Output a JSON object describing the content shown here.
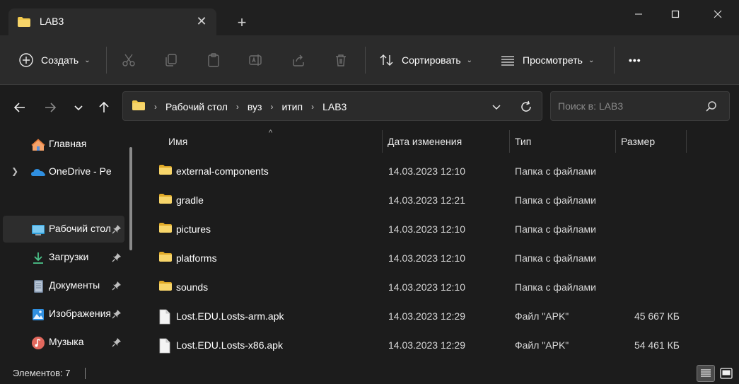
{
  "window": {
    "tab_title": "LAB3",
    "tab_close_glyph": "✕",
    "new_tab_glyph": "+"
  },
  "toolbar": {
    "create_label": "Создать",
    "sort_label": "Сортировать",
    "view_label": "Просмотреть",
    "more_glyph": "•••",
    "icons": [
      "plus-circle-icon",
      "scissors-icon",
      "copy-icon",
      "paste-icon",
      "rename-icon",
      "share-icon",
      "delete-icon",
      "sort-icon",
      "view-icon",
      "more-icon"
    ]
  },
  "address": {
    "breadcrumb": [
      "Рабочий стол",
      "вуз",
      "итип",
      "LAB3"
    ],
    "separator": "›"
  },
  "search": {
    "placeholder": "Поиск в: LAB3"
  },
  "sidebar": {
    "items": [
      {
        "label": "Главная",
        "icon": "home-icon",
        "expandable": false,
        "pinned": false,
        "active": false
      },
      {
        "label": "OneDrive - Personal",
        "icon": "onedrive-icon",
        "expandable": true,
        "pinned": false,
        "active": false
      },
      {
        "label": "Рабочий стол",
        "icon": "desktop-icon",
        "expandable": false,
        "pinned": true,
        "active": true
      },
      {
        "label": "Загрузки",
        "icon": "downloads-icon",
        "expandable": false,
        "pinned": true,
        "active": false
      },
      {
        "label": "Документы",
        "icon": "documents-icon",
        "expandable": false,
        "pinned": true,
        "active": false
      },
      {
        "label": "Изображения",
        "icon": "pictures-icon",
        "expandable": false,
        "pinned": true,
        "active": false
      },
      {
        "label": "Музыка",
        "icon": "music-icon",
        "expandable": false,
        "pinned": true,
        "active": false
      }
    ]
  },
  "filelist": {
    "columns": {
      "name": "Имя",
      "date": "Дата изменения",
      "type": "Тип",
      "size": "Размер"
    },
    "sort_glyph": "^",
    "rows": [
      {
        "name": "external-components",
        "date": "14.03.2023 12:10",
        "type": "Папка с файлами",
        "size": "",
        "kind": "folder"
      },
      {
        "name": "gradle",
        "date": "14.03.2023 12:21",
        "type": "Папка с файлами",
        "size": "",
        "kind": "folder"
      },
      {
        "name": "pictures",
        "date": "14.03.2023 12:10",
        "type": "Папка с файлами",
        "size": "",
        "kind": "folder"
      },
      {
        "name": "platforms",
        "date": "14.03.2023 12:10",
        "type": "Папка с файлами",
        "size": "",
        "kind": "folder"
      },
      {
        "name": "sounds",
        "date": "14.03.2023 12:10",
        "type": "Папка с файлами",
        "size": "",
        "kind": "folder"
      },
      {
        "name": "Lost.EDU.Losts-arm.apk",
        "date": "14.03.2023 12:29",
        "type": "Файл \"APK\"",
        "size": "45 667 КБ",
        "kind": "file"
      },
      {
        "name": "Lost.EDU.Losts-x86.apk",
        "date": "14.03.2023 12:29",
        "type": "Файл \"APK\"",
        "size": "54 461 КБ",
        "kind": "file"
      }
    ]
  },
  "status": {
    "items_count": "Элементов: 7"
  },
  "colors": {
    "background": "#1c1c1c",
    "toolbar": "#2b2b2b",
    "folder_yellow": "#f2c94c",
    "onedrive_blue": "#2f8fe0",
    "downloads_green": "#4cc38a"
  }
}
